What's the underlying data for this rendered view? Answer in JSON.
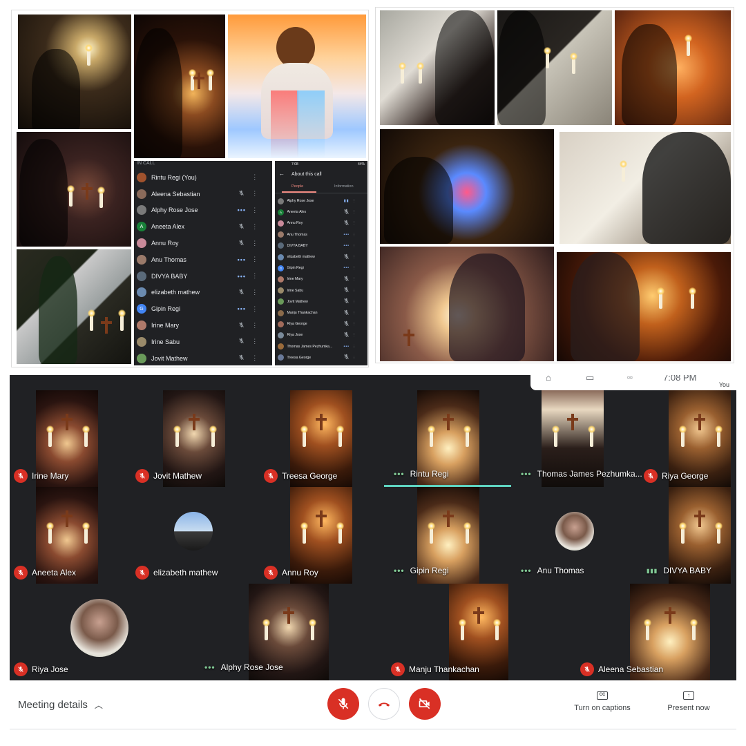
{
  "phone_left": {
    "header": "IN CALL",
    "participants": [
      {
        "name": "Rintu Regi (You)",
        "status": "none",
        "avatar_color": "#a0522d",
        "initial": ""
      },
      {
        "name": "Aleena Sebastian",
        "status": "muted",
        "avatar_color": "#8a6a5a",
        "initial": ""
      },
      {
        "name": "Alphy Rose Jose",
        "status": "speaking",
        "avatar_color": "#7a7a7a",
        "initial": ""
      },
      {
        "name": "Aneeta Alex",
        "status": "muted",
        "avatar_color": "#188038",
        "initial": "A"
      },
      {
        "name": "Annu Roy",
        "status": "muted",
        "avatar_color": "#c98a9a",
        "initial": ""
      },
      {
        "name": "Anu Thomas",
        "status": "speaking",
        "avatar_color": "#9a7a6a",
        "initial": ""
      },
      {
        "name": "DIVYA BABY",
        "status": "speaking",
        "avatar_color": "#5a6a7a",
        "initial": ""
      },
      {
        "name": "elizabeth mathew",
        "status": "muted",
        "avatar_color": "#6a8ab0",
        "initial": ""
      },
      {
        "name": "Gipin Regi",
        "status": "speaking",
        "avatar_color": "#4285f4",
        "initial": "G"
      },
      {
        "name": "Irine Mary",
        "status": "muted",
        "avatar_color": "#b07a6a",
        "initial": ""
      },
      {
        "name": "Irine Sabu",
        "status": "muted",
        "avatar_color": "#9a8a6a",
        "initial": ""
      },
      {
        "name": "Jovit Mathew",
        "status": "muted",
        "avatar_color": "#6a9a5a",
        "initial": ""
      }
    ]
  },
  "phone_right": {
    "time": "7:08",
    "battery": "44%",
    "title": "About this call",
    "tabs": [
      "People",
      "Information"
    ],
    "participants": [
      {
        "name": "Alphy Rose Jose",
        "status": "talking",
        "avatar_color": "#7a7a7a",
        "initial": ""
      },
      {
        "name": "Aneeta Alex",
        "status": "muted",
        "avatar_color": "#188038",
        "initial": "A"
      },
      {
        "name": "Annu Roy",
        "status": "muted",
        "avatar_color": "#c98a9a",
        "initial": ""
      },
      {
        "name": "Anu Thomas",
        "status": "speaking",
        "avatar_color": "#9a7a6a",
        "initial": ""
      },
      {
        "name": "DIVYA BABY",
        "status": "speaking",
        "avatar_color": "#5a6a7a",
        "initial": ""
      },
      {
        "name": "elizabeth mathew",
        "status": "muted",
        "avatar_color": "#6a8ab0",
        "initial": ""
      },
      {
        "name": "Gipin Regi",
        "status": "speaking",
        "avatar_color": "#4285f4",
        "initial": "G"
      },
      {
        "name": "Irine Mary",
        "status": "muted",
        "avatar_color": "#b07a6a",
        "initial": ""
      },
      {
        "name": "Irine Sabu",
        "status": "muted",
        "avatar_color": "#9a8a6a",
        "initial": ""
      },
      {
        "name": "Jovit Mathew",
        "status": "muted",
        "avatar_color": "#6a9a5a",
        "initial": ""
      },
      {
        "name": "Manju Thankachan",
        "status": "muted",
        "avatar_color": "#8a6a4a",
        "initial": ""
      },
      {
        "name": "Riya George",
        "status": "muted",
        "avatar_color": "#a06a5a",
        "initial": ""
      },
      {
        "name": "Riya Jose",
        "status": "muted",
        "avatar_color": "#7a8a9a",
        "initial": ""
      },
      {
        "name": "Thomas James Pezhumka...",
        "status": "speaking",
        "avatar_color": "#9a6a3a",
        "initial": ""
      },
      {
        "name": "Treesa George",
        "status": "muted",
        "avatar_color": "#6a7a9a",
        "initial": ""
      }
    ]
  },
  "meet": {
    "clock": "7:08 PM",
    "you_label": "You",
    "tiles": [
      {
        "name": "Irine Mary",
        "status": "muted"
      },
      {
        "name": "Jovit Mathew",
        "status": "muted"
      },
      {
        "name": "Treesa George",
        "status": "muted"
      },
      {
        "name": "Rintu Regi",
        "status": "speaking"
      },
      {
        "name": "Thomas James Pezhumka...",
        "status": "speaking"
      },
      {
        "name": "Riya George",
        "status": "muted"
      },
      {
        "name": "Aneeta Alex",
        "status": "muted"
      },
      {
        "name": "elizabeth mathew",
        "status": "muted"
      },
      {
        "name": "Annu Roy",
        "status": "muted"
      },
      {
        "name": "Gipin Regi",
        "status": "speaking"
      },
      {
        "name": "Anu Thomas",
        "status": "speaking"
      },
      {
        "name": "DIVYA BABY",
        "status": "talking"
      },
      {
        "name": "Riya Jose",
        "status": "muted"
      },
      {
        "name": "Alphy Rose Jose",
        "status": "speaking"
      },
      {
        "name": "Manju Thankachan",
        "status": "muted"
      },
      {
        "name": "Aleena Sebastian",
        "status": "muted"
      }
    ],
    "meeting_details": "Meeting details",
    "captions_label": "Turn on captions",
    "present_label": "Present now",
    "colors": {
      "red": "#d93025",
      "active_bar": "#5ed4c0",
      "speaking": "#81c995"
    }
  }
}
